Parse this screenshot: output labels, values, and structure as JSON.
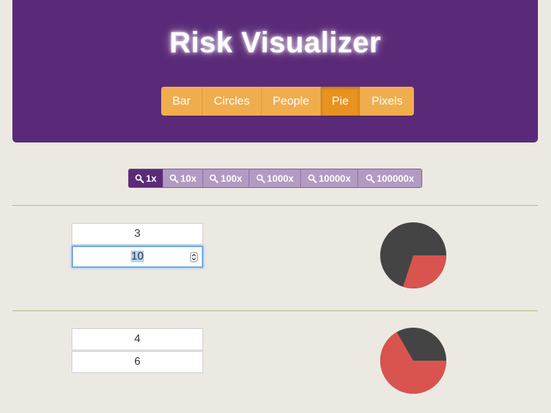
{
  "header": {
    "title": "Risk Visualizer",
    "background": "#5a2a78"
  },
  "viz_tabs": [
    {
      "label": "Bar",
      "active": false
    },
    {
      "label": "Circles",
      "active": false
    },
    {
      "label": "People",
      "active": false
    },
    {
      "label": "Pie",
      "active": true
    },
    {
      "label": "Pixels",
      "active": false
    }
  ],
  "zoom_buttons": [
    {
      "label": "1x",
      "icon": "search-icon",
      "active": true
    },
    {
      "label": "10x",
      "icon": "search-icon",
      "active": false
    },
    {
      "label": "100x",
      "icon": "search-icon",
      "active": false
    },
    {
      "label": "1000x",
      "icon": "search-icon",
      "active": false
    },
    {
      "label": "10000x",
      "icon": "search-icon",
      "active": false
    },
    {
      "label": "100000x",
      "icon": "search-icon",
      "active": false
    }
  ],
  "rows": [
    {
      "numerator": "3",
      "denominator": "10",
      "denominator_focused": true,
      "fraction": 0.3
    },
    {
      "numerator": "4",
      "denominator": "6",
      "denominator_focused": false,
      "fraction": 0.6667
    }
  ],
  "colors": {
    "pie_dark": "#444444",
    "pie_risk": "#d9534f",
    "tab_bg": "#f0ad4e",
    "tab_active": "#e8921f",
    "zoom_bg": "#b19bc2",
    "zoom_active": "#5a2a78"
  }
}
